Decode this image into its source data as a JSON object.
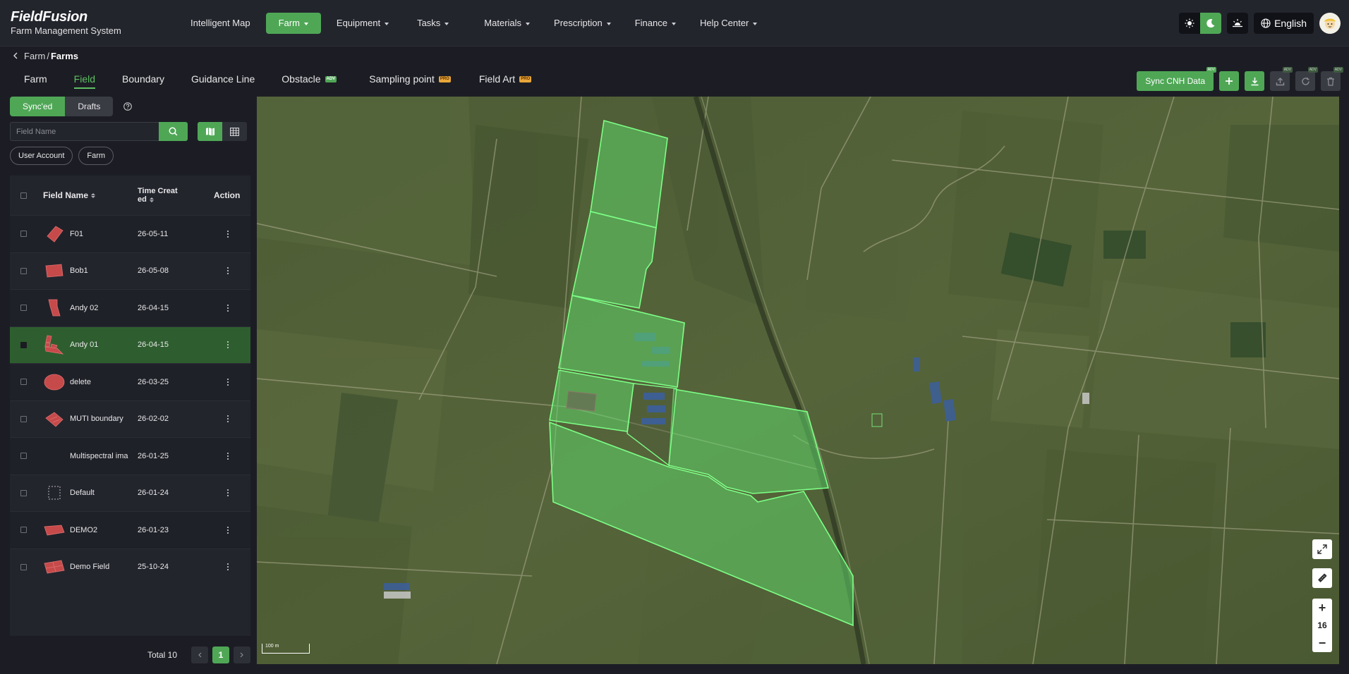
{
  "app": {
    "brand": "FieldFusion",
    "subtitle": "Farm Management System"
  },
  "nav": [
    {
      "label": "Intelligent Map",
      "dropdown": false,
      "active": false
    },
    {
      "label": "Farm",
      "dropdown": true,
      "active": true
    },
    {
      "label": "Equipment",
      "dropdown": true,
      "active": false
    },
    {
      "label": "Tasks",
      "dropdown": true,
      "active": false
    },
    {
      "label": "Materials",
      "dropdown": true,
      "active": false
    },
    {
      "label": "Prescription",
      "dropdown": true,
      "active": false
    },
    {
      "label": "Finance",
      "dropdown": true,
      "active": false
    },
    {
      "label": "Help Center",
      "dropdown": true,
      "active": false
    }
  ],
  "header_right": {
    "theme_modes": [
      "sun-icon",
      "moon-icon"
    ],
    "active_mode": "moon-icon",
    "language": "English"
  },
  "breadcrumb": {
    "parent": "Farm",
    "separator": "/",
    "current": "Farms"
  },
  "tabs": [
    {
      "label": "Farm",
      "tag": ""
    },
    {
      "label": "Field",
      "tag": "",
      "active": true
    },
    {
      "label": "Boundary",
      "tag": ""
    },
    {
      "label": "Guidance Line",
      "tag": ""
    },
    {
      "label": "Obstacle",
      "tag": "ADV"
    },
    {
      "label": "Sampling point",
      "tag": "PRO"
    },
    {
      "label": "Field Art",
      "tag": "PRO"
    }
  ],
  "toolbar": {
    "sync_label": "Sync CNH Data",
    "sync_badge": "ADV",
    "badge": "ADV"
  },
  "panel": {
    "segments": [
      "Sync'ed",
      "Drafts"
    ],
    "active_segment": "Sync'ed",
    "search_placeholder": "Field Name",
    "chips": [
      "User Account",
      "Farm"
    ]
  },
  "table": {
    "columns": {
      "name": "Field Name",
      "time_line1": "Time Creat",
      "time_line2": "ed",
      "action": "Action"
    },
    "rows": [
      {
        "name": "F01",
        "time": "26-05-11",
        "shape": "quad"
      },
      {
        "name": "Bob1",
        "time": "26-05-08",
        "shape": "rect"
      },
      {
        "name": "Andy 02",
        "time": "26-04-15",
        "shape": "flag"
      },
      {
        "name": "Andy 01",
        "time": "26-04-15",
        "shape": "multi",
        "selected": true
      },
      {
        "name": "delete",
        "time": "26-03-25",
        "shape": "ellipse"
      },
      {
        "name": "MUTI boundary",
        "time": "26-02-02",
        "shape": "diamond"
      },
      {
        "name": "Multispectral ima",
        "time": "26-01-25",
        "shape": "none"
      },
      {
        "name": "Default",
        "time": "26-01-24",
        "shape": "dashed"
      },
      {
        "name": "DEMO2",
        "time": "26-01-23",
        "shape": "slab"
      },
      {
        "name": "Demo Field",
        "time": "25-10-24",
        "shape": "grid"
      }
    ]
  },
  "pager": {
    "total": "Total 10",
    "page": "1"
  },
  "map": {
    "scale": "100 m",
    "zoom": "16",
    "boundary_color": "#7dff86",
    "fill_color": "#5fd66a"
  }
}
